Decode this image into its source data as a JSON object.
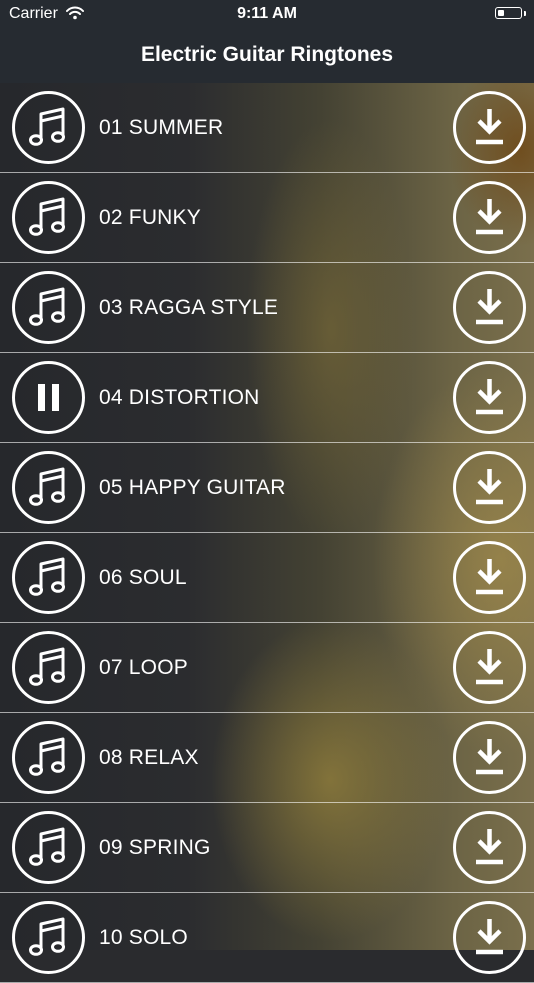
{
  "status_bar": {
    "carrier": "Carrier",
    "time": "9:11 AM",
    "wifi_icon": "wifi-icon",
    "battery_icon": "battery-icon"
  },
  "nav": {
    "title": "Electric Guitar Ringtones"
  },
  "ringtones": [
    {
      "title": "01 SUMMER",
      "state_icon": "music-note-icon"
    },
    {
      "title": "02 FUNKY",
      "state_icon": "music-note-icon"
    },
    {
      "title": "03 RAGGA STYLE",
      "state_icon": "music-note-icon"
    },
    {
      "title": "04 DISTORTION",
      "state_icon": "pause-icon"
    },
    {
      "title": "05 HAPPY GUITAR",
      "state_icon": "music-note-icon"
    },
    {
      "title": "06 SOUL",
      "state_icon": "music-note-icon"
    },
    {
      "title": "07 LOOP",
      "state_icon": "music-note-icon"
    },
    {
      "title": "08 RELAX",
      "state_icon": "music-note-icon"
    },
    {
      "title": "09 SPRING",
      "state_icon": "music-note-icon"
    },
    {
      "title": "10 SOLO",
      "state_icon": "music-note-icon"
    }
  ],
  "row_action_icon": "download-icon"
}
